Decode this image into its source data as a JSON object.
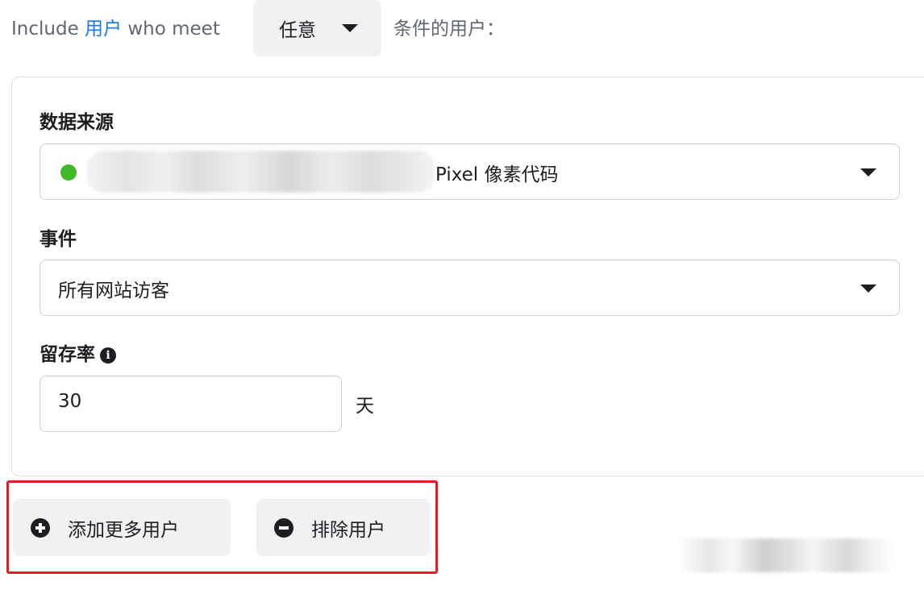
{
  "include": {
    "prefix": "Include",
    "link_text": "用户",
    "middle": "who meet",
    "any_value": "任意",
    "suffix": "条件的用户："
  },
  "source": {
    "label": "数据来源",
    "value_suffix": "Pixel 像素代码",
    "status_color": "#42b72a"
  },
  "event": {
    "label": "事件",
    "value": "所有网站访客"
  },
  "retention": {
    "label": "留存率",
    "value": "30",
    "unit": "天"
  },
  "actions": {
    "add_label": "添加更多用户",
    "exclude_label": "排除用户"
  },
  "colors": {
    "link": "#1877f2",
    "highlight": "#e02020",
    "button_bg": "#f0f1f3"
  }
}
